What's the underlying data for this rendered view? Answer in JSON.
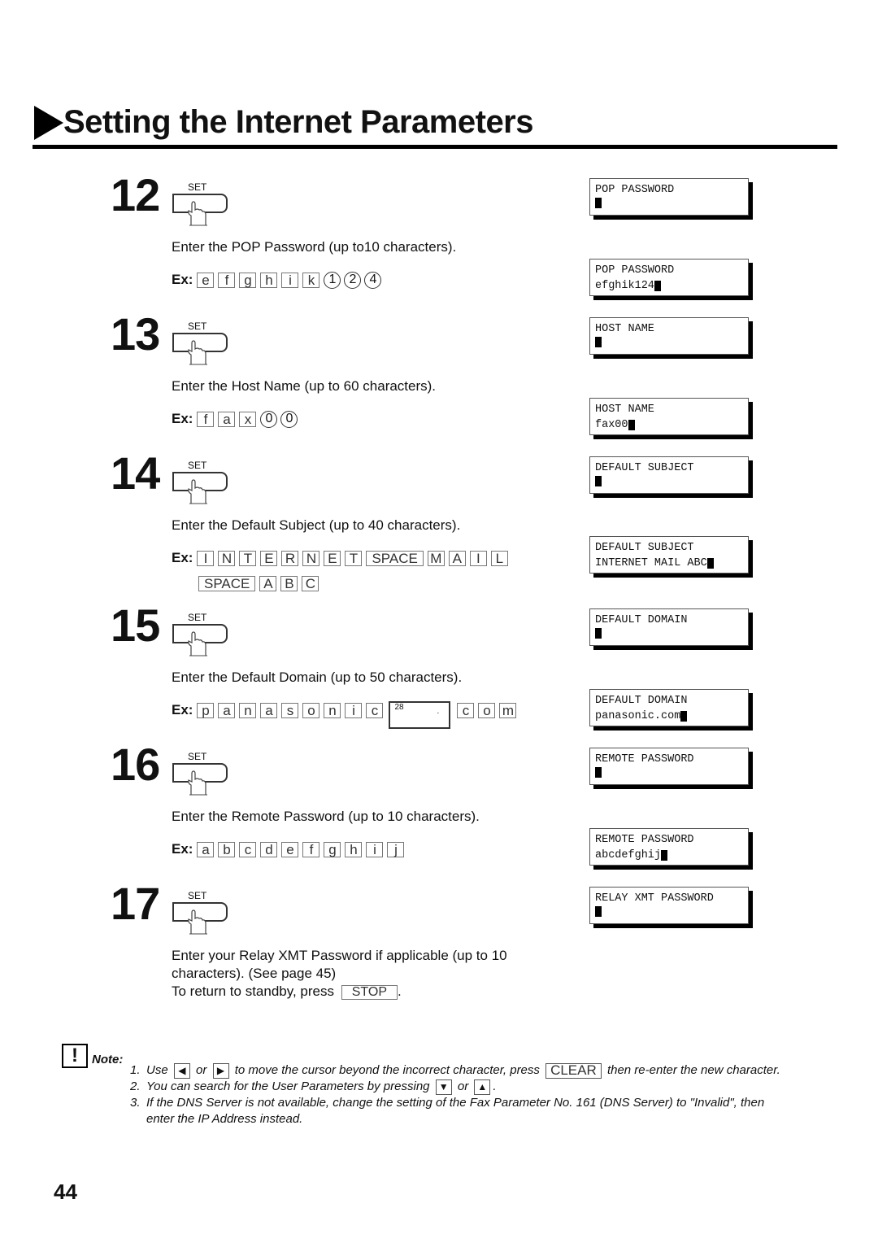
{
  "header": {
    "title": "Setting the Internet Parameters"
  },
  "set_key_label": "SET",
  "ex_label": "Ex:",
  "steps": [
    {
      "number": "12",
      "instruction": "Enter the POP Password (up to10 characters).",
      "example_keys": [
        {
          "t": "key",
          "v": "e"
        },
        {
          "t": "key",
          "v": "f"
        },
        {
          "t": "key",
          "v": "g"
        },
        {
          "t": "key",
          "v": "h"
        },
        {
          "t": "key",
          "v": "i"
        },
        {
          "t": "key",
          "v": "k"
        },
        {
          "t": "circ",
          "v": "1"
        },
        {
          "t": "circ",
          "v": "2"
        },
        {
          "t": "circ",
          "v": "4"
        }
      ],
      "displays": [
        {
          "line1": "POP PASSWORD",
          "line2": ""
        },
        {
          "line1": "POP PASSWORD",
          "line2": "efghik124"
        }
      ]
    },
    {
      "number": "13",
      "instruction": "Enter the Host Name (up to 60 characters).",
      "example_keys": [
        {
          "t": "key",
          "v": "f"
        },
        {
          "t": "key",
          "v": "a"
        },
        {
          "t": "key",
          "v": "x"
        },
        {
          "t": "circ",
          "v": "0"
        },
        {
          "t": "circ",
          "v": "0"
        }
      ],
      "displays": [
        {
          "line1": "HOST NAME",
          "line2": ""
        },
        {
          "line1": "HOST NAME",
          "line2": "fax00"
        }
      ]
    },
    {
      "number": "14",
      "instruction": "Enter the Default Subject (up to 40 characters).",
      "example_keys": [
        {
          "t": "key",
          "v": "I"
        },
        {
          "t": "key",
          "v": "N"
        },
        {
          "t": "key",
          "v": "T"
        },
        {
          "t": "key",
          "v": "E"
        },
        {
          "t": "key",
          "v": "R"
        },
        {
          "t": "key",
          "v": "N"
        },
        {
          "t": "key",
          "v": "E"
        },
        {
          "t": "key",
          "v": "T"
        },
        {
          "t": "wide",
          "v": "SPACE"
        },
        {
          "t": "key",
          "v": "M"
        },
        {
          "t": "key",
          "v": "A"
        },
        {
          "t": "key",
          "v": "I"
        },
        {
          "t": "key",
          "v": "L"
        }
      ],
      "example_keys_line2": [
        {
          "t": "wide",
          "v": "SPACE"
        },
        {
          "t": "key",
          "v": "A"
        },
        {
          "t": "key",
          "v": "B"
        },
        {
          "t": "key",
          "v": "C"
        }
      ],
      "displays": [
        {
          "line1": "DEFAULT SUBJECT",
          "line2": ""
        },
        {
          "line1": "DEFAULT SUBJECT",
          "line2": "INTERNET MAIL ABC"
        }
      ]
    },
    {
      "number": "15",
      "instruction": "Enter the Default Domain (up to 50 characters).",
      "example_keys": [
        {
          "t": "key",
          "v": "p"
        },
        {
          "t": "key",
          "v": "a"
        },
        {
          "t": "key",
          "v": "n"
        },
        {
          "t": "key",
          "v": "a"
        },
        {
          "t": "key",
          "v": "s"
        },
        {
          "t": "key",
          "v": "o"
        },
        {
          "t": "key",
          "v": "n"
        },
        {
          "t": "key",
          "v": "i"
        },
        {
          "t": "key",
          "v": "c"
        },
        {
          "t": "dot",
          "v": "28",
          "d": "."
        },
        {
          "t": "key",
          "v": "c"
        },
        {
          "t": "key",
          "v": "o"
        },
        {
          "t": "key",
          "v": "m"
        }
      ],
      "displays": [
        {
          "line1": "DEFAULT DOMAIN",
          "line2": ""
        },
        {
          "line1": "DEFAULT DOMAIN",
          "line2": "panasonic.com"
        }
      ]
    },
    {
      "number": "16",
      "instruction": "Enter the Remote Password (up to 10 characters).",
      "example_keys": [
        {
          "t": "key",
          "v": "a"
        },
        {
          "t": "key",
          "v": "b"
        },
        {
          "t": "key",
          "v": "c"
        },
        {
          "t": "key",
          "v": "d"
        },
        {
          "t": "key",
          "v": "e"
        },
        {
          "t": "key",
          "v": "f"
        },
        {
          "t": "key",
          "v": "g"
        },
        {
          "t": "key",
          "v": "h"
        },
        {
          "t": "key",
          "v": "i"
        },
        {
          "t": "key",
          "v": "j"
        }
      ],
      "displays": [
        {
          "line1": "REMOTE PASSWORD",
          "line2": ""
        },
        {
          "line1": "REMOTE PASSWORD",
          "line2": "abcdefghij"
        }
      ]
    },
    {
      "number": "17",
      "instruction_lines": [
        "Enter your Relay XMT Password if applicable (up to 10",
        "characters). (See page 45)"
      ],
      "standby_prefix": "To return to standby, press",
      "stop_key": "STOP",
      "standby_suffix": ".",
      "displays": [
        {
          "line1": "RELAY XMT PASSWORD",
          "line2": ""
        }
      ]
    }
  ],
  "note": {
    "label": "Note:",
    "icon": "exclamation-icon",
    "items": [
      {
        "num": "1.",
        "parts": [
          "Use",
          "left-arrow-key",
          "or",
          "right-arrow-key",
          "to move the cursor beyond the incorrect character, press",
          "CLEAR",
          "then re-enter the new character."
        ]
      },
      {
        "num": "2.",
        "parts": [
          "You can search for the User Parameters by pressing",
          "down-arrow-key",
          "or",
          "up-arrow-key",
          "."
        ]
      },
      {
        "num": "3.",
        "text": "If the DNS Server is not available, change the setting of the Fax Parameter No. 161 (DNS Server) to \"Invalid\", then enter the IP Address instead."
      }
    ],
    "n1_use": "Use",
    "n1_or": "or",
    "n1_mid": "to move the cursor beyond the incorrect character, press",
    "n1_clear": "CLEAR",
    "n1_end": "then re-enter the new character.",
    "n2_text": "You can search for the User Parameters by pressing",
    "n2_or": "or",
    "n2_end": ".",
    "n3_line1": "If the DNS Server is not available, change the setting of the Fax Parameter No. 161 (DNS Server) to \"Invalid\", then",
    "n3_line2": "enter the IP Address instead."
  },
  "page_number": "44"
}
